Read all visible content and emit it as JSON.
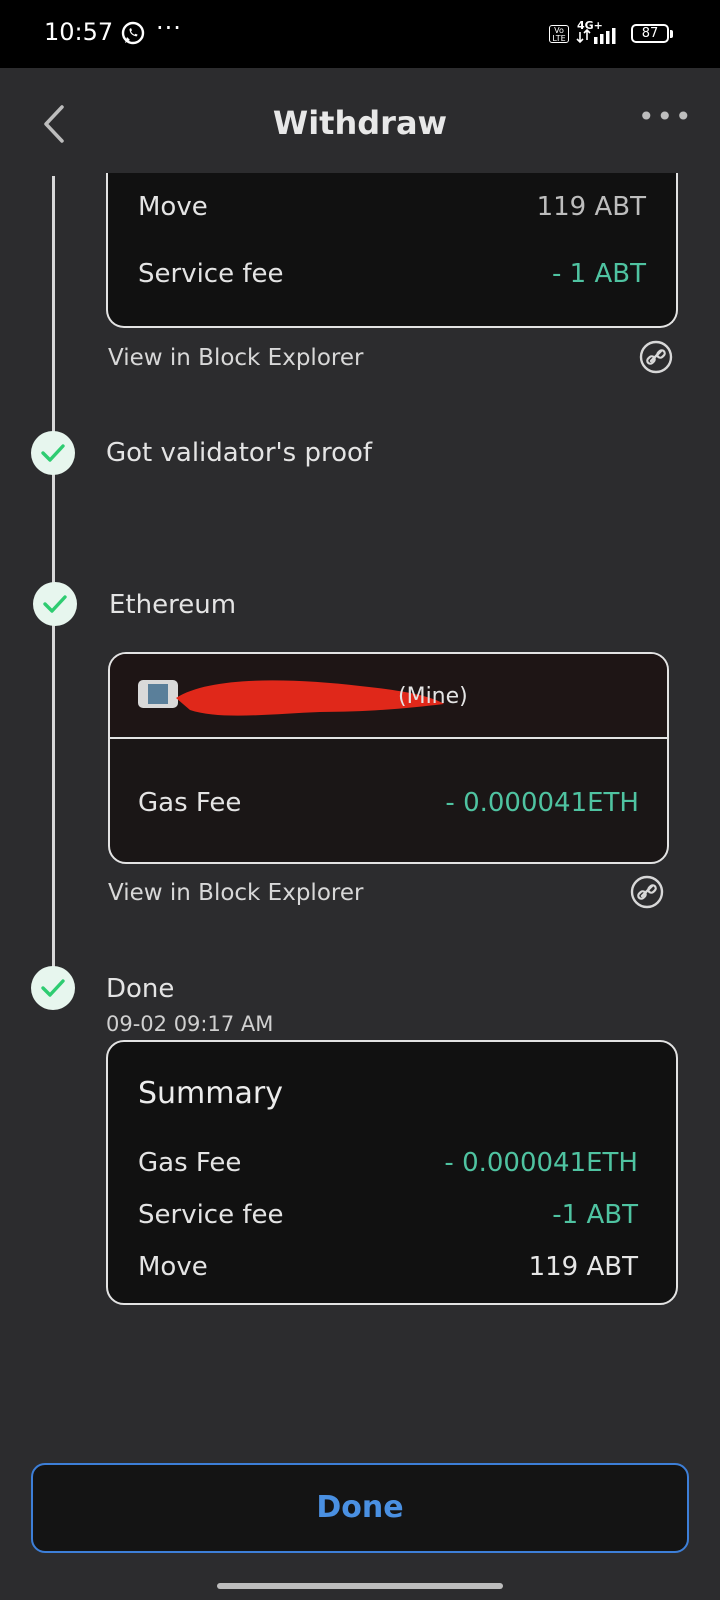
{
  "status_bar": {
    "time": "10:57",
    "network": "4G+",
    "volte": "Vo LTE",
    "battery": "87"
  },
  "header": {
    "title": "Withdraw",
    "back_icon": "chevron-left-icon",
    "more_icon": "more-horizontal-icon"
  },
  "top_card": {
    "rows": [
      {
        "label": "Move",
        "value": "119 ABT"
      },
      {
        "label": "Service fee",
        "value": "- 1 ABT"
      }
    ],
    "explorer_link": "View in Block Explorer"
  },
  "steps": {
    "proof": "Got validator's proof",
    "ethereum": "Ethereum",
    "done": "Done",
    "done_time": "09-02 09:17 AM"
  },
  "eth_card": {
    "account_suffix": "(Mine)",
    "gas_label": "Gas Fee",
    "gas_value": "- 0.000041ETH",
    "explorer_link": "View in Block Explorer"
  },
  "summary": {
    "title": "Summary",
    "rows": [
      {
        "label": "Gas Fee",
        "value": "- 0.000041ETH"
      },
      {
        "label": "Service fee",
        "value": "-1 ABT"
      },
      {
        "label": "Move",
        "value": "119 ABT"
      }
    ]
  },
  "footer": {
    "done_button": "Done"
  },
  "colors": {
    "accent_green": "#4fc3a1",
    "button_blue": "#4a90e2",
    "check_green": "#2ecc71"
  }
}
